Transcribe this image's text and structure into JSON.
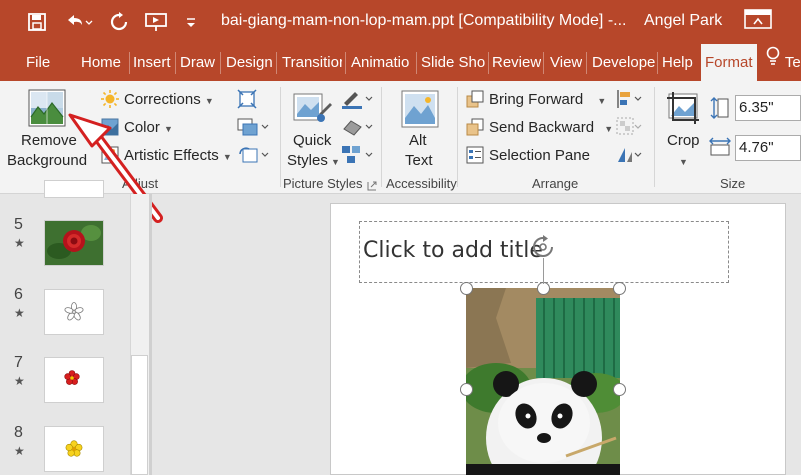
{
  "titlebar": {
    "doc_title": "bai-giang-mam-non-lop-mam.ppt [Compatibility Mode]  -...",
    "user_name": "Angel Park"
  },
  "tabs": [
    "File",
    "Home",
    "Insert",
    "Draw",
    "Design",
    "Transitior",
    "Animatio",
    "Slide Sho",
    "Review",
    "View",
    "Develope",
    "Help",
    "Format",
    "Te"
  ],
  "ribbon": {
    "adjust": {
      "remove_bg_line1": "Remove",
      "remove_bg_line2": "Background",
      "corrections": "Corrections",
      "color": "Color",
      "artistic_effects": "Artistic Effects",
      "group_label": "Adjust"
    },
    "picture_styles": {
      "quick_styles_line1": "Quick",
      "quick_styles_line2": "Styles",
      "group_label": "Picture Styles"
    },
    "accessibility": {
      "alt_text_line1": "Alt",
      "alt_text_line2": "Text",
      "group_label": "Accessibility"
    },
    "arrange": {
      "bring_forward": "Bring Forward",
      "send_backward": "Send Backward",
      "selection_pane": "Selection Pane",
      "group_label": "Arrange"
    },
    "size": {
      "crop": "Crop",
      "height": "6.35\"",
      "width": "4.76\"",
      "group_label": "Size"
    }
  },
  "thumbnails": [
    {
      "num": "5",
      "star": "★",
      "kind": "rose"
    },
    {
      "num": "6",
      "star": "★",
      "kind": "white-flower"
    },
    {
      "num": "7",
      "star": "★",
      "kind": "red-flower"
    },
    {
      "num": "8",
      "star": "★",
      "kind": "yellow-flower"
    }
  ],
  "slide": {
    "title_placeholder": "Click to add title"
  },
  "colors": {
    "accent": "#b7472a",
    "ribbon_bg": "#f3f3f3",
    "arrow": "#d42020"
  }
}
